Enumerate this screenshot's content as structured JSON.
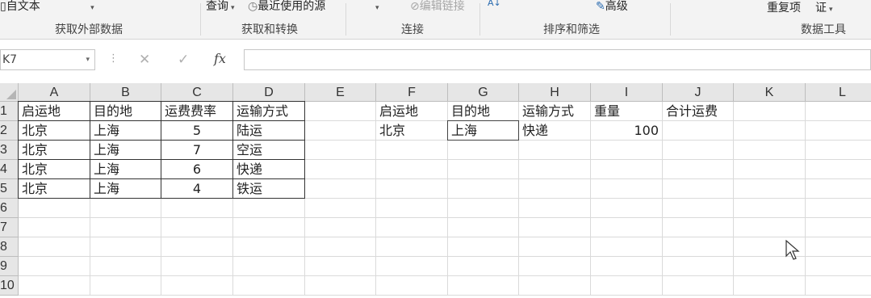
{
  "ribbon": {
    "items": {
      "from_text": "自文本",
      "query": "查询",
      "recent_sources": "最近使用的源",
      "edit_links": "编辑链接",
      "sort_az": "A↓",
      "advanced": "高级",
      "remove_dup": "重复项",
      "validation": "证"
    },
    "groups": {
      "get_external": "获取外部数据",
      "get_transform": "获取和转换",
      "connections": "连接",
      "sort_filter": "排序和筛选",
      "data_tools": "数据工具"
    }
  },
  "formula_bar": {
    "name_box": "K7",
    "fx": "fx",
    "formula": ""
  },
  "columns": [
    "A",
    "B",
    "C",
    "D",
    "E",
    "F",
    "G",
    "H",
    "I",
    "J",
    "K",
    "L"
  ],
  "rows": [
    "1",
    "2",
    "3",
    "4",
    "5",
    "6",
    "7",
    "8",
    "9",
    "10"
  ],
  "cells": {
    "A1": "启运地",
    "B1": "目的地",
    "C1": "运费费率",
    "D1": "运输方式",
    "A2": "北京",
    "B2": "上海",
    "C2": "5",
    "D2": "陆运",
    "A3": "北京",
    "B3": "上海",
    "C3": "7",
    "D3": "空运",
    "A4": "北京",
    "B4": "上海",
    "C4": "6",
    "D4": "快递",
    "A5": "北京",
    "B5": "上海",
    "C5": "4",
    "D5": "铁运",
    "F1": "启运地",
    "G1": "目的地",
    "H1": "运输方式",
    "I1": "重量",
    "J1": "合计运费",
    "F2": "北京",
    "G2": "上海",
    "H2": "快递",
    "I2": "100"
  }
}
